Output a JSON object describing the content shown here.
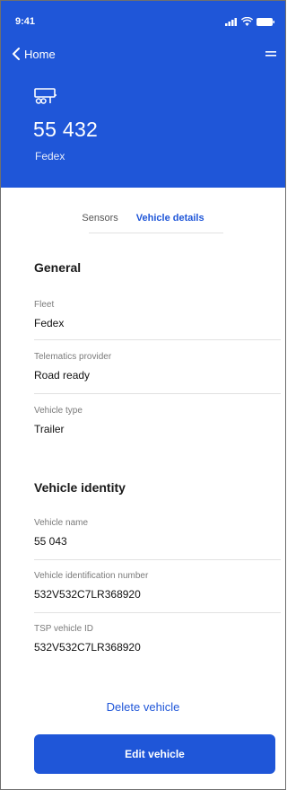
{
  "status_bar": {
    "time": "9:41",
    "signal_icon": "signal-icon",
    "wifi_icon": "wifi-icon",
    "battery_icon": "battery-icon"
  },
  "nav": {
    "back_label": "Home",
    "back_icon": "chevron-left-icon",
    "menu_icon": "menu-icon"
  },
  "vehicle": {
    "icon": "trailer-icon",
    "number": "55 432",
    "fleet": "Fedex"
  },
  "tabs": [
    {
      "label": "Sensors",
      "active": false
    },
    {
      "label": "Vehicle details",
      "active": true
    }
  ],
  "general": {
    "title": "General",
    "fields": [
      {
        "label": "Fleet",
        "value": "Fedex"
      },
      {
        "label": "Telematics provider",
        "value": "Road ready"
      },
      {
        "label": "Vehicle type",
        "value": "Trailer"
      }
    ]
  },
  "identity": {
    "title": "Vehicle identity",
    "fields": [
      {
        "label": "Vehicle name",
        "value": "55 043"
      },
      {
        "label": "Vehicle identification number",
        "value": "532V532C7LR368920"
      },
      {
        "label": "TSP vehicle ID",
        "value": "532V532C7LR368920"
      }
    ]
  },
  "actions": {
    "delete_label": "Delete vehicle",
    "edit_label": "Edit vehicle"
  },
  "colors": {
    "brand_blue": "#1f56d8",
    "background": "#ffffff"
  }
}
